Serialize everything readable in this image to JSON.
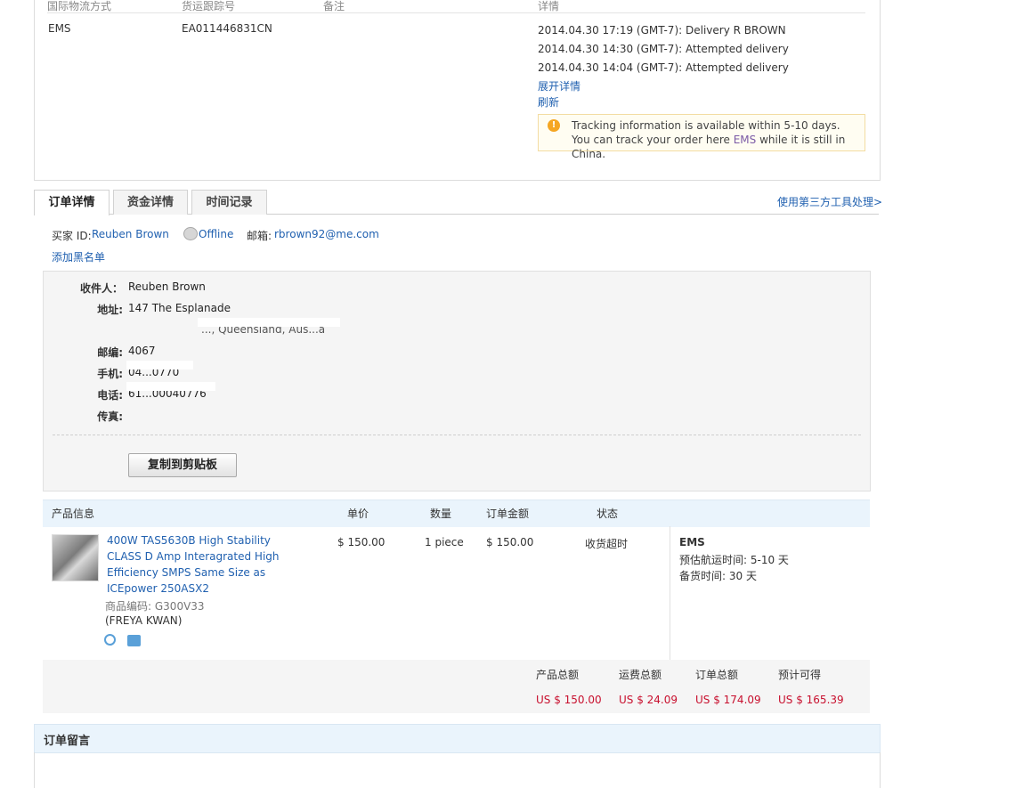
{
  "shipping": {
    "headers": [
      "国际物流方式",
      "货运跟踪号",
      "备注",
      "详情"
    ],
    "method": "EMS",
    "tracking_number": "EA011446831CN",
    "events": [
      "2014.04.30 17:19 (GMT-7): Delivery R BROWN",
      "2014.04.30 14:30 (GMT-7): Attempted delivery",
      "2014.04.30 14:04 (GMT-7): Attempted delivery"
    ],
    "expand_link": "展开详情",
    "refresh_link": "刷新",
    "tip_icon": "lightbulb-icon",
    "tip_prefix": "Tracking information is available within 5-10 days. You can track your order here ",
    "tip_link": "EMS",
    "tip_suffix": " while it is still in China."
  },
  "tabs": [
    "订单详情",
    "资金详情",
    "时间记录"
  ],
  "third_party_link": "使用第三方工具处理>",
  "buyer": {
    "id_label": "买家 ID:",
    "name": "Reuben Brown",
    "status_icon": "chat-bubble-icon",
    "status": "Offline",
    "email_label": "邮箱:",
    "email": "rbrown92@me.com",
    "blacklist_link": "添加黑名单"
  },
  "address": {
    "recipient_label": "收件人：",
    "recipient": "Reuben Brown",
    "address_label": "地址:",
    "address_line1": "147 The Esplanade",
    "address_line2": "...,  Queensland, Aus...a",
    "zip_label": "邮编:",
    "zip": "4067",
    "mobile_label": "手机:",
    "mobile": "04...0770",
    "phone_label": "电话:",
    "phone": "61...00040776",
    "fax_label": "传真:",
    "copy_button": "复制到剪贴板"
  },
  "product_table": {
    "headers": [
      "产品信息",
      "单价",
      "数量",
      "订单金额",
      "状态"
    ],
    "product": {
      "title": "400W TAS5630B High Stability CLASS D Amp Interagrated High Efficiency SMPS Same Size as ICEpower 250ASX2",
      "sku_label": "商品编码:",
      "sku": "G300V33",
      "seller": "(FREYA KWAN)",
      "icons": [
        "alarm-clock-icon",
        "refresh-box-icon"
      ],
      "unit_price": "$ 150.00",
      "quantity": "1 piece",
      "amount": "$ 150.00",
      "status": "收货超时",
      "shipping_method": "EMS",
      "eta_label": "预估航运时间:",
      "eta": "5-10 天",
      "prep_label": "备货时间:",
      "prep": "30 天"
    }
  },
  "totals": {
    "labels": [
      "产品总额",
      "运费总额",
      "订单总额",
      "预计可得"
    ],
    "values": [
      "US $ 150.00",
      "US $ 24.09",
      "US $ 174.09",
      "US $ 165.39"
    ]
  },
  "message": {
    "title": "订单留言"
  },
  "colors": {
    "link": "#2161b0",
    "price_red": "#c8102e",
    "header_blue": "#eaf4fc"
  }
}
